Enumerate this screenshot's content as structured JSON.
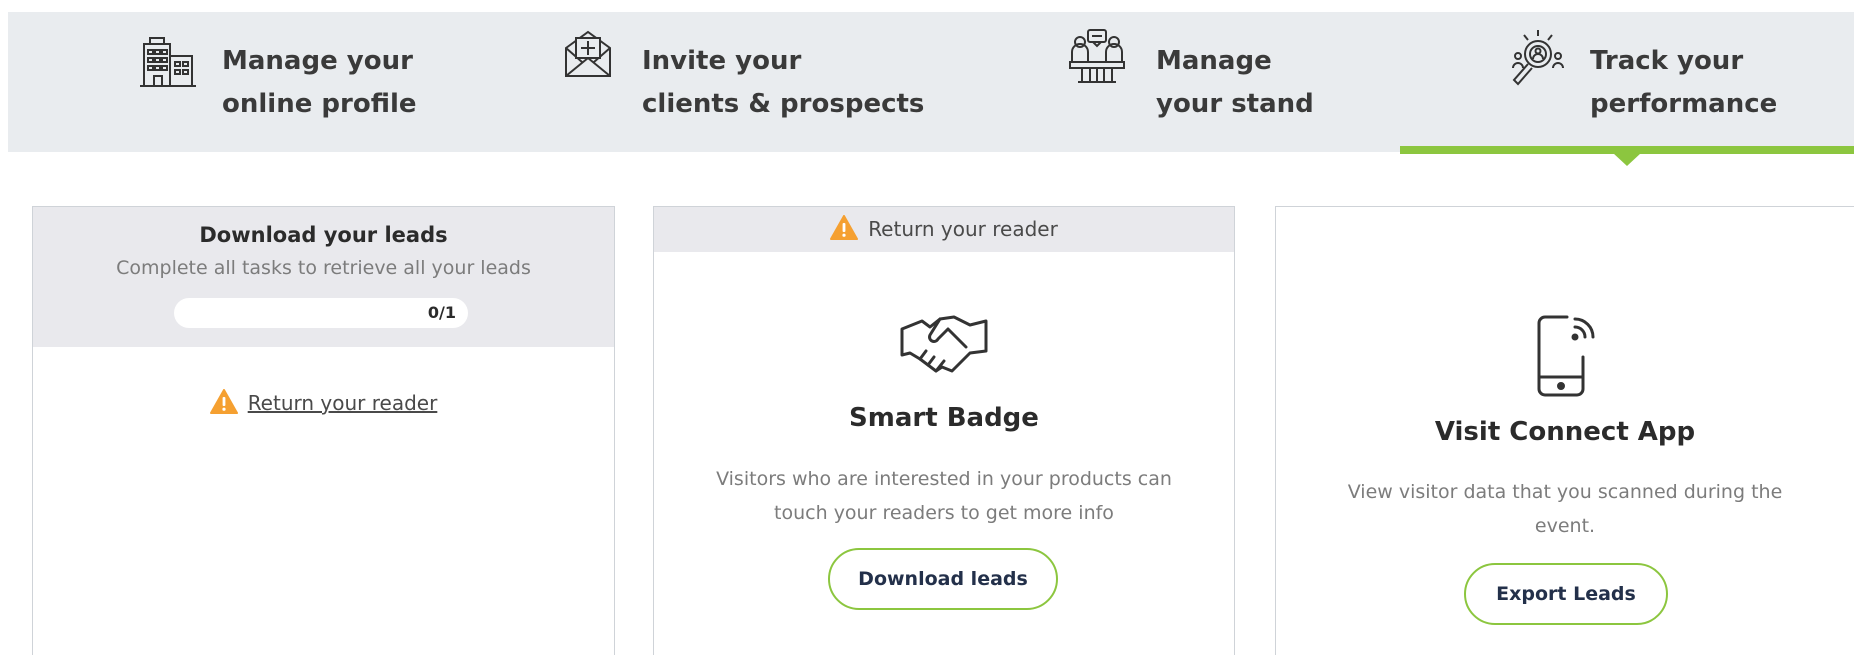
{
  "tabs": [
    {
      "line1": "Manage your",
      "line2": "online profile",
      "icon": "building-icon"
    },
    {
      "line1": "Invite your",
      "line2": "clients & prospects",
      "icon": "envelope-add-icon"
    },
    {
      "line1": "Manage",
      "line2": "your stand",
      "icon": "stand-people-icon"
    },
    {
      "line1": "Track your",
      "line2": "performance",
      "icon": "magnify-person-icon",
      "active": true
    }
  ],
  "leads_card": {
    "title": "Download your leads",
    "subtitle": "Complete all tasks to retrieve all your leads",
    "progress_text": "0/1",
    "progress_fraction": 0,
    "reader_link": "Return your reader",
    "warning_icon": "warning-icon"
  },
  "smart_badge_card": {
    "banner_text": "Return your reader",
    "icon": "handshake-icon",
    "title": "Smart Badge",
    "description": "Visitors who are interested in your products can touch your readers to get more info",
    "button_label": "Download leads"
  },
  "connect_app_card": {
    "icon": "phone-nfc-icon",
    "title": "Visit Connect App",
    "description": "View visitor data that you scanned during the event.",
    "button_label": "Export Leads"
  },
  "colors": {
    "accent": "#8cc63f",
    "warning": "#f5a031",
    "panel_bg": "#e9ecef"
  }
}
